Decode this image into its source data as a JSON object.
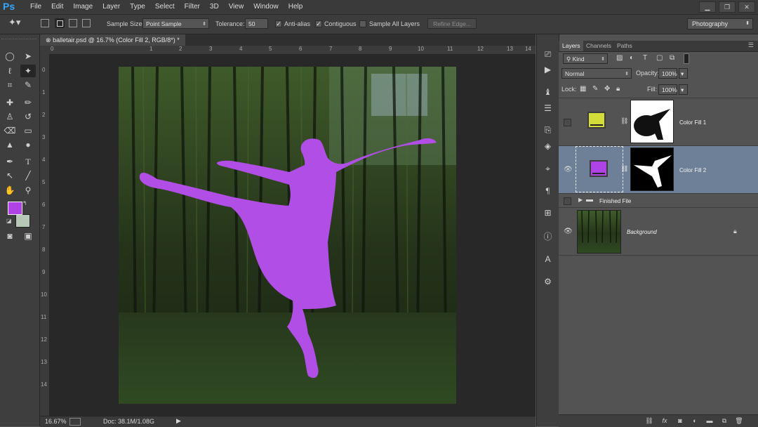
{
  "app": {
    "logo": "Ps"
  },
  "menu": [
    "File",
    "Edit",
    "Image",
    "Layer",
    "Type",
    "Select",
    "Filter",
    "3D",
    "View",
    "Window",
    "Help"
  ],
  "window_controls": {
    "minimize": "▁",
    "restore": "❐",
    "close": "✕"
  },
  "options": {
    "sample_size_label": "Sample Size:",
    "sample_size_value": "Point Sample",
    "tolerance_label": "Tolerance:",
    "tolerance_value": "50",
    "anti_alias_label": "Anti-alias",
    "anti_alias_checked": true,
    "contiguous_label": "Contiguous",
    "contiguous_checked": true,
    "sample_all_layers_label": "Sample All Layers",
    "sample_all_layers_checked": false,
    "refine_edge_label": "Refine Edge..."
  },
  "workspace": "Photography",
  "document": {
    "tab_title": "balletair.psd @ 16.7% (Color Fill 2, RGB/8*) *",
    "close_glyph": "⊗",
    "ruler_h_ticks": [
      "0",
      "1",
      "2",
      "3",
      "4",
      "5",
      "6",
      "7",
      "8",
      "9",
      "10",
      "11",
      "12",
      "13",
      "14"
    ],
    "ruler_v_ticks": [
      "0",
      "1",
      "2",
      "3",
      "4",
      "5",
      "6",
      "7",
      "8",
      "9",
      "10",
      "11",
      "12",
      "13",
      "14"
    ],
    "zoom": "16.67%",
    "doc_size": "Doc: 38.1M/1.08G"
  },
  "colors": {
    "foreground": "#b043e6",
    "background": "#b8c8b8",
    "silhouette": "#b14ee6",
    "color_fill_1": "#d4dc3a",
    "selection": "#6e7f98"
  },
  "layers_panel": {
    "tabs": [
      "Layers",
      "Channels",
      "Paths"
    ],
    "filter_kind": "Kind",
    "blend_mode": "Normal",
    "opacity_label": "Opacity:",
    "opacity_value": "100%",
    "lock_label": "Lock:",
    "fill_label": "Fill:",
    "fill_value": "100%",
    "layers": [
      {
        "name": "Color Fill 1",
        "visible": false
      },
      {
        "name": "Color Fill 2",
        "visible": true,
        "selected": true
      },
      {
        "name": "Finished File",
        "type": "group",
        "visible": false
      },
      {
        "name": "Background",
        "visible": true,
        "locked": true
      }
    ]
  }
}
